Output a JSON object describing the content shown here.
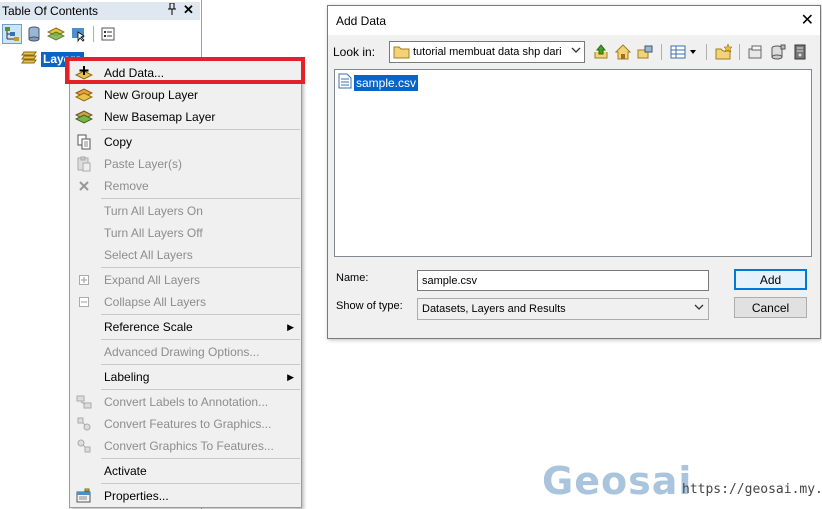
{
  "toc": {
    "title": "Table Of Contents",
    "pin_icon": "pin-icon",
    "close_glyph": "✕",
    "layers_label": "Layers",
    "toolbar_icons": [
      "list-by-drawing-order-icon",
      "list-by-source-icon",
      "list-by-visibility-icon",
      "list-by-selection-icon",
      "options-icon"
    ]
  },
  "context_menu": {
    "items": [
      {
        "label": "Add Data...",
        "icon": "add-data-icon",
        "enabled": true,
        "highlighted": true
      },
      {
        "label": "New Group Layer",
        "icon": "group-layer-icon",
        "enabled": true
      },
      {
        "label": "New Basemap Layer",
        "icon": "basemap-layer-icon",
        "enabled": true
      },
      {
        "label": "Copy",
        "icon": "copy-icon",
        "enabled": true
      },
      {
        "label": "Paste Layer(s)",
        "icon": "paste-icon",
        "enabled": false
      },
      {
        "label": "Remove",
        "icon": "remove-icon",
        "enabled": false
      },
      {
        "label": "Turn All Layers On",
        "enabled": false
      },
      {
        "label": "Turn All Layers Off",
        "enabled": false
      },
      {
        "label": "Select All Layers",
        "enabled": false
      },
      {
        "label": "Expand All Layers",
        "icon": "expand-icon",
        "enabled": false
      },
      {
        "label": "Collapse All Layers",
        "icon": "collapse-icon",
        "enabled": false
      },
      {
        "label": "Reference Scale",
        "enabled": true,
        "submenu": true
      },
      {
        "label": "Advanced Drawing Options...",
        "enabled": false
      },
      {
        "label": "Labeling",
        "enabled": true,
        "submenu": true
      },
      {
        "label": "Convert Labels to Annotation...",
        "icon": "convert-labels-icon",
        "enabled": false
      },
      {
        "label": "Convert Features to Graphics...",
        "icon": "convert-features-icon",
        "enabled": false
      },
      {
        "label": "Convert Graphics To Features...",
        "icon": "convert-graphics-icon",
        "enabled": false
      },
      {
        "label": "Activate",
        "enabled": true
      },
      {
        "label": "Properties...",
        "icon": "properties-icon",
        "enabled": true
      }
    ],
    "submenu_glyph": "▶"
  },
  "dialog": {
    "title": "Add Data",
    "close_glyph": "✕",
    "look_in_label": "Look in:",
    "look_in_value": "tutorial membuat data shp dari t",
    "files": [
      {
        "name": "sample.csv",
        "icon": "csv-file-icon"
      }
    ],
    "name_label": "Name:",
    "name_value": "sample.csv",
    "type_label": "Show of type:",
    "type_value": "Datasets, Layers and Results",
    "add_button": "Add",
    "cancel_button": "Cancel",
    "toolbar_icons": [
      "up-one-level-icon",
      "home-icon",
      "connect-folder-icon",
      "view-options-icon",
      "new-folder-icon",
      "catalog-icon",
      "database-icon",
      "server-icon"
    ]
  },
  "watermark": {
    "logo": "Geosai",
    "url": "https://geosai.my.id"
  },
  "colors": {
    "selection": "#0a64c8",
    "highlight_box": "#e32128",
    "watermark": "#a9c4dc"
  }
}
